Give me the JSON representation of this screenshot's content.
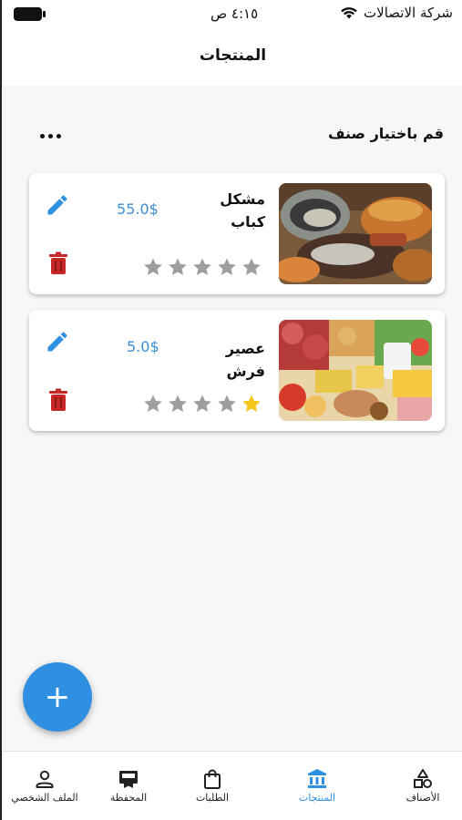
{
  "status_bar": {
    "time": "٤:١٥ ص",
    "carrier": "شركة الاتصالات"
  },
  "header": {
    "title": "المنتجات"
  },
  "category": {
    "label": "قم باختيار صنف"
  },
  "products": [
    {
      "name": "مشكل كباب",
      "price": "55.0$",
      "rating": 0,
      "max_rating": 5
    },
    {
      "name": "عصير فرش",
      "price": "5.0$",
      "rating": 1,
      "max_rating": 5
    }
  ],
  "fab": {
    "symbol": "+"
  },
  "nav": {
    "items": [
      {
        "label": "الأصناف",
        "icon": "categories-icon"
      },
      {
        "label": "المنتجات",
        "icon": "bank-icon",
        "active": true
      },
      {
        "label": "الطلبات",
        "icon": "shopping-bag-icon"
      },
      {
        "label": "المحفظة",
        "icon": "wallet-icon"
      },
      {
        "label": "الملف الشخصي",
        "icon": "person-icon"
      }
    ]
  },
  "colors": {
    "accent": "#2f8fe2",
    "price": "#3d8fd8",
    "delete": "#c62828",
    "star_active": "#f5c518",
    "star_inactive": "#9e9e9e"
  }
}
